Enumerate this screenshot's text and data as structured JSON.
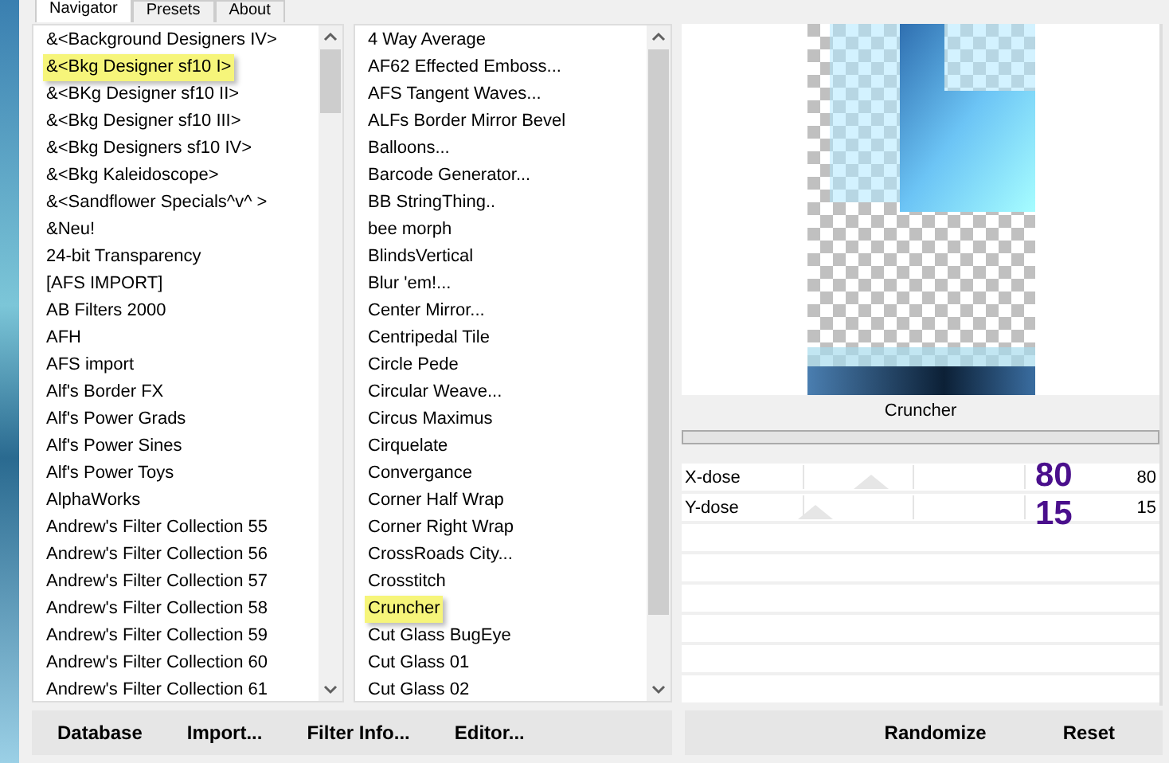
{
  "tabs": [
    {
      "label": "Navigator",
      "selected": true
    },
    {
      "label": "Presets",
      "selected": false
    },
    {
      "label": "About",
      "selected": false
    }
  ],
  "categories": [
    {
      "label": "&<Background Designers IV>",
      "highlighted": false
    },
    {
      "label": "&<Bkg Designer sf10 I>",
      "highlighted": true
    },
    {
      "label": "&<BKg Designer sf10 II>",
      "highlighted": false
    },
    {
      "label": "&<Bkg Designer sf10 III>",
      "highlighted": false
    },
    {
      "label": "&<Bkg Designers sf10 IV>",
      "highlighted": false
    },
    {
      "label": "&<Bkg Kaleidoscope>",
      "highlighted": false
    },
    {
      "label": "&<Sandflower Specials^v^ >",
      "highlighted": false
    },
    {
      "label": "&Neu!",
      "highlighted": false
    },
    {
      "label": "24-bit Transparency",
      "highlighted": false
    },
    {
      "label": "[AFS IMPORT]",
      "highlighted": false
    },
    {
      "label": "AB Filters 2000",
      "highlighted": false
    },
    {
      "label": "AFH",
      "highlighted": false
    },
    {
      "label": "AFS import",
      "highlighted": false
    },
    {
      "label": "Alf's Border FX",
      "highlighted": false
    },
    {
      "label": "Alf's Power Grads",
      "highlighted": false
    },
    {
      "label": "Alf's Power Sines",
      "highlighted": false
    },
    {
      "label": "Alf's Power Toys",
      "highlighted": false
    },
    {
      "label": "AlphaWorks",
      "highlighted": false
    },
    {
      "label": "Andrew's Filter Collection 55",
      "highlighted": false
    },
    {
      "label": "Andrew's Filter Collection 56",
      "highlighted": false
    },
    {
      "label": "Andrew's Filter Collection 57",
      "highlighted": false
    },
    {
      "label": "Andrew's Filter Collection 58",
      "highlighted": false
    },
    {
      "label": "Andrew's Filter Collection 59",
      "highlighted": false
    },
    {
      "label": "Andrew's Filter Collection 60",
      "highlighted": false
    },
    {
      "label": "Andrew's Filter Collection 61",
      "highlighted": false
    }
  ],
  "filters": [
    {
      "label": "4 Way Average",
      "highlighted": false
    },
    {
      "label": "AF62 Effected Emboss...",
      "highlighted": false
    },
    {
      "label": "AFS Tangent Waves...",
      "highlighted": false
    },
    {
      "label": "ALFs Border Mirror Bevel",
      "highlighted": false
    },
    {
      "label": "Balloons...",
      "highlighted": false
    },
    {
      "label": "Barcode Generator...",
      "highlighted": false
    },
    {
      "label": "BB StringThing..",
      "highlighted": false
    },
    {
      "label": "bee morph",
      "highlighted": false
    },
    {
      "label": "BlindsVertical",
      "highlighted": false
    },
    {
      "label": "Blur 'em!...",
      "highlighted": false
    },
    {
      "label": "Center Mirror...",
      "highlighted": false
    },
    {
      "label": "Centripedal Tile",
      "highlighted": false
    },
    {
      "label": "Circle Pede",
      "highlighted": false
    },
    {
      "label": "Circular Weave...",
      "highlighted": false
    },
    {
      "label": "Circus Maximus",
      "highlighted": false
    },
    {
      "label": "Cirquelate",
      "highlighted": false
    },
    {
      "label": "Convergance",
      "highlighted": false
    },
    {
      "label": "Corner Half Wrap",
      "highlighted": false
    },
    {
      "label": "Corner Right Wrap",
      "highlighted": false
    },
    {
      "label": "CrossRoads City...",
      "highlighted": false
    },
    {
      "label": "Crosstitch",
      "highlighted": false
    },
    {
      "label": "Cruncher",
      "highlighted": true
    },
    {
      "label": "Cut Glass  BugEye",
      "highlighted": false
    },
    {
      "label": "Cut Glass 01",
      "highlighted": false
    },
    {
      "label": "Cut Glass 02",
      "highlighted": false
    }
  ],
  "filter_name": "Cruncher",
  "progress": {
    "level": 0
  },
  "parameters": [
    {
      "name": "X-dose",
      "value": "80",
      "level": 0.31,
      "annotation": "80"
    },
    {
      "name": "Y-dose",
      "value": "15",
      "level": 0.06,
      "annotation": "15"
    }
  ],
  "buttons": [
    {
      "label": "Database"
    },
    {
      "label": "Import..."
    },
    {
      "label": "Filter Info..."
    },
    {
      "label": "Editor..."
    }
  ],
  "right_buttons": [
    {
      "label": "Randomize"
    },
    {
      "label": "Reset"
    }
  ]
}
